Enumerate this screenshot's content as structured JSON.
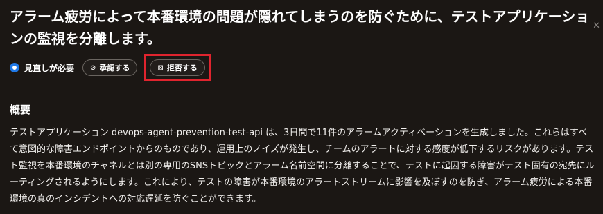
{
  "title": "アラーム疲労によって本番環境の問題が隠れてしまうのを防ぐために、テストアプリケーションの監視を分離します。",
  "status": {
    "label": "見直しが必要",
    "color": "#1f78e6"
  },
  "buttons": {
    "approve": {
      "icon": "check-circle-icon",
      "label": "承認する"
    },
    "reject": {
      "icon": "x-square-icon",
      "label": "拒否する"
    }
  },
  "highlight_color": "#e0242e",
  "summary": {
    "heading": "概要",
    "body": "テストアプリケーション devops-agent-prevention-test-api は、3日間で11件のアラームアクティベーションを生成しました。これらはすべて意図的な障害エンドポイントからのものであり、運用上のノイズが発生し、チームのアラートに対する感度が低下するリスクがあります。テスト監視を本番環境のチャネルとは別の専用のSNSトピックとアラーム名前空間に分離することで、テストに起因する障害がテスト固有の宛先にルーティングされるようにします。これにより、テストの障害が本番環境のアラートストリームに影響を及ぼすのを防ぎ、アラーム疲労による本番環境の真のインシデントへの対応遅延を防ぐことができます。"
  }
}
